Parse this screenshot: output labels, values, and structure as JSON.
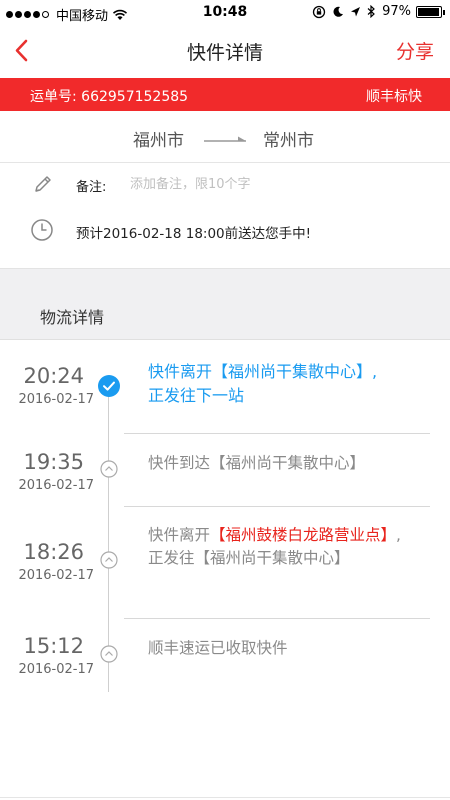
{
  "status_bar": {
    "signal_bars": 4,
    "carrier": "中国移动",
    "time": "10:48",
    "battery_text": "97%",
    "battery_level": 0.97
  },
  "nav": {
    "back_icon": "chevron-left-icon",
    "title": "快件详情",
    "share_label": "分享"
  },
  "banner": {
    "waybill_label": "运单号:",
    "waybill_number": "662957152585",
    "courier": "顺丰标快"
  },
  "route": {
    "from": "福州市",
    "to": "常州市"
  },
  "note": {
    "label": "备注:",
    "placeholder": "添加备注，限10个字"
  },
  "eta": {
    "text": "预计2016-02-18 18:00前送达您手中!"
  },
  "section": {
    "title": "物流详情"
  },
  "events": [
    {
      "time": "20:24",
      "date": "2016-02-17",
      "text_prefix": "快件离开【福州尚干集散中心】,",
      "text_suffix": "正发往下一站",
      "highlight": ""
    },
    {
      "time": "19:35",
      "date": "2016-02-17",
      "text_prefix": "快件到达【福州尚干集散中心】",
      "text_suffix": "",
      "highlight": ""
    },
    {
      "time": "18:26",
      "date": "2016-02-17",
      "text_prefix": "快件离开",
      "highlight": "【福州鼓楼白龙路营业点】",
      "text_suffix": ",正发往【福州尚干集散中心】"
    },
    {
      "time": "15:12",
      "date": "2016-02-17",
      "text_prefix": "顺丰速运已收取快件",
      "text_suffix": "",
      "highlight": ""
    }
  ],
  "colors": {
    "brand_red": "#f12a2b",
    "active_blue": "#1a9bf0",
    "highlight_red": "#e8231c"
  }
}
